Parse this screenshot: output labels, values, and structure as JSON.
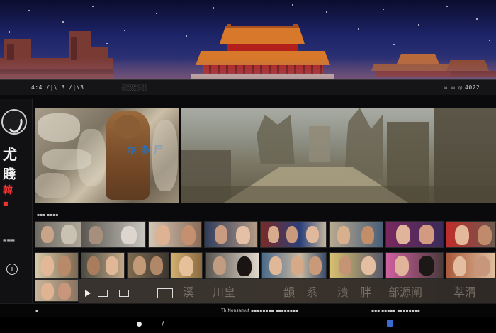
{
  "window": {
    "title_left": "4:4 /|\\ 3 /|\\3",
    "title_center": "░░░░░░░",
    "status_right": "4022",
    "status_icons": "▭ ▭ ◎"
  },
  "sidebar": {
    "glyphs": [
      "尤",
      "賤",
      "韓"
    ],
    "small_label": "▬▬▬",
    "info_label": "i"
  },
  "hero": {
    "left_overlay": "尔 多 尸"
  },
  "section_label": "▪▪▪ ▪▪▪▪",
  "partial_row_text": [
    "溪",
    "川皇",
    "韻",
    "系",
    "渍",
    "胖",
    "部源阐",
    "萃渭"
  ],
  "bottom_bar": {
    "left_marker": "▪",
    "center_text": "Th Nonsamut  ▪▪▪▪▪▪▪▪ ▪▪▪▪▪▪▪▪",
    "right_text": "▪▪▪ ▪▪▪▪▪ ▪▪▪▪▪▪▪▪"
  },
  "colors": {
    "accent_red": "#e33333",
    "nav_blue": "#3a6bd1",
    "sky_top": "#0b0d2e",
    "palace_roof": "#d8782a"
  }
}
